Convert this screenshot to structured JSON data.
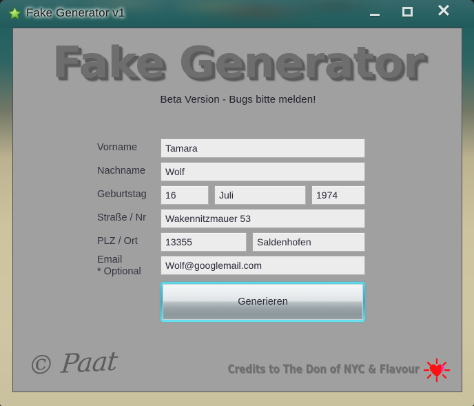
{
  "window": {
    "title": "Fake Generator v1",
    "icon": "green-star-icon",
    "controls": {
      "minimize": "–",
      "maximize": "☐",
      "close": "✕"
    }
  },
  "banner": {
    "logo": "Fake Generator",
    "subtitle": "Beta Version - Bugs bitte melden!"
  },
  "form": {
    "rows": [
      {
        "label": "Vorname",
        "values": [
          "Tamara"
        ]
      },
      {
        "label": "Nachname",
        "values": [
          "Wolf"
        ]
      },
      {
        "label": "Geburtstag",
        "values": [
          "16",
          "Juli",
          "1974"
        ]
      },
      {
        "label": "Straße / Nr",
        "values": [
          "Wakennitzmauer 53"
        ]
      },
      {
        "label": "PLZ / Ort",
        "values": [
          "13355",
          "Saldenhofen"
        ]
      },
      {
        "label_line1": "Email",
        "label_line2": "* Optional",
        "values": [
          "Wolf@googlemail.com"
        ]
      }
    ],
    "vorname_label": "Vorname",
    "vorname_value": "Tamara",
    "nachname_label": "Nachname",
    "nachname_value": "Wolf",
    "geburtstag_label": "Geburtstag",
    "geburtstag_day": "16",
    "geburtstag_month": "Juli",
    "geburtstag_year": "1974",
    "strasse_label": "Straße / Nr",
    "strasse_value": "Wakennitzmauer 53",
    "plz_ort_label": "PLZ / Ort",
    "plz_value": "13355",
    "ort_value": "Saldenhofen",
    "email_label_line1": "Email",
    "email_label_line2": "* Optional",
    "email_value": "Wolf@googlemail.com"
  },
  "actions": {
    "generate": "Generieren"
  },
  "footer": {
    "signature": "© Paat",
    "credits": "Credits to The Don of NYC & Flavour",
    "heart_icon": "shining-heart-icon"
  },
  "colors": {
    "client_bg": "#a0a0a0",
    "titlebar_teal": "#22605f",
    "frame_tan": "#d4cca4",
    "logo_gray": "#6e6e6e",
    "field_bg": "#ececec",
    "focus_glow": "#49c2d8",
    "heart_red": "#fa1212",
    "heart_pink": "#ff2fae",
    "star_green": "#6fc043"
  }
}
